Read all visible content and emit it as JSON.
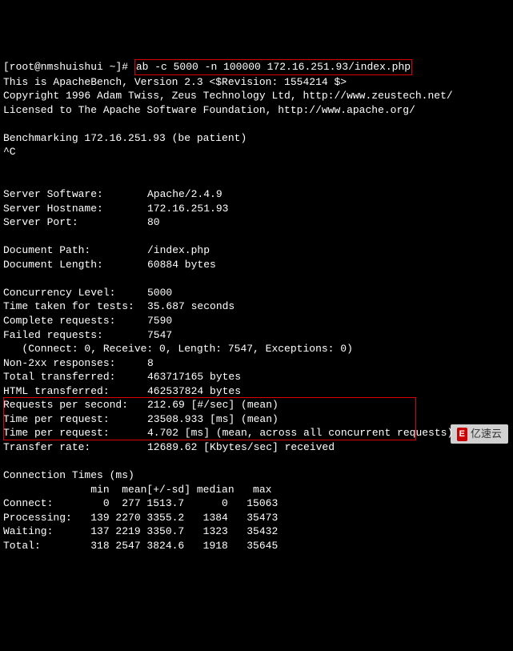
{
  "prompt": "[root@nmshuishui ~]# ",
  "command": "ab -c 5000 -n 100000 172.16.251.93/index.php",
  "header": {
    "line1": "This is ApacheBench, Version 2.3 <$Revision: 1554214 $>",
    "line2": "Copyright 1996 Adam Twiss, Zeus Technology Ltd, http://www.zeustech.net/",
    "line3": "Licensed to The Apache Software Foundation, http://www.apache.org/"
  },
  "benchmark_line": "Benchmarking 172.16.251.93 (be patient)",
  "ctrlc": "^C",
  "server": {
    "software_label": "Server Software:",
    "software": "Apache/2.4.9",
    "hostname_label": "Server Hostname:",
    "hostname": "172.16.251.93",
    "port_label": "Server Port:",
    "port": "80"
  },
  "doc": {
    "path_label": "Document Path:",
    "path": "/index.php",
    "len_label": "Document Length:",
    "len": "60884 bytes"
  },
  "conc": {
    "level_label": "Concurrency Level:",
    "level": "5000",
    "time_label": "Time taken for tests:",
    "time": "35.687 seconds",
    "complete_label": "Complete requests:",
    "complete": "7590",
    "failed_label": "Failed requests:",
    "failed": "7547",
    "failed_detail": "   (Connect: 0, Receive: 0, Length: 7547, Exceptions: 0)",
    "non2xx_label": "Non-2xx responses:",
    "non2xx": "8",
    "total_label": "Total transferred:",
    "total": "463717165 bytes",
    "html_label": "HTML transferred:",
    "html": "462537824 bytes"
  },
  "stats": {
    "rps_label": "Requests per second:",
    "rps": "212.69 [#/sec] (mean)",
    "tpr1_label": "Time per request:",
    "tpr1": "23508.933 [ms] (mean)",
    "tpr2_label": "Time per request:",
    "tpr2": "4.702 [ms] (mean, across all concurrent requests)"
  },
  "transfer": {
    "label": "Transfer rate:",
    "val": "12689.62 [Kbytes/sec] received"
  },
  "ct": {
    "title": "Connection Times (ms)",
    "header": "              min  mean[+/-sd] median   max",
    "connect": "Connect:        0  277 1513.7      0   15063",
    "processing": "Processing:   139 2270 3355.2   1384   35473",
    "waiting": "Waiting:      137 2219 3350.7   1323   35432",
    "total": "Total:        318 2547 3824.6   1918   35645"
  },
  "watermark": {
    "logo": "E",
    "text": "亿速云"
  }
}
